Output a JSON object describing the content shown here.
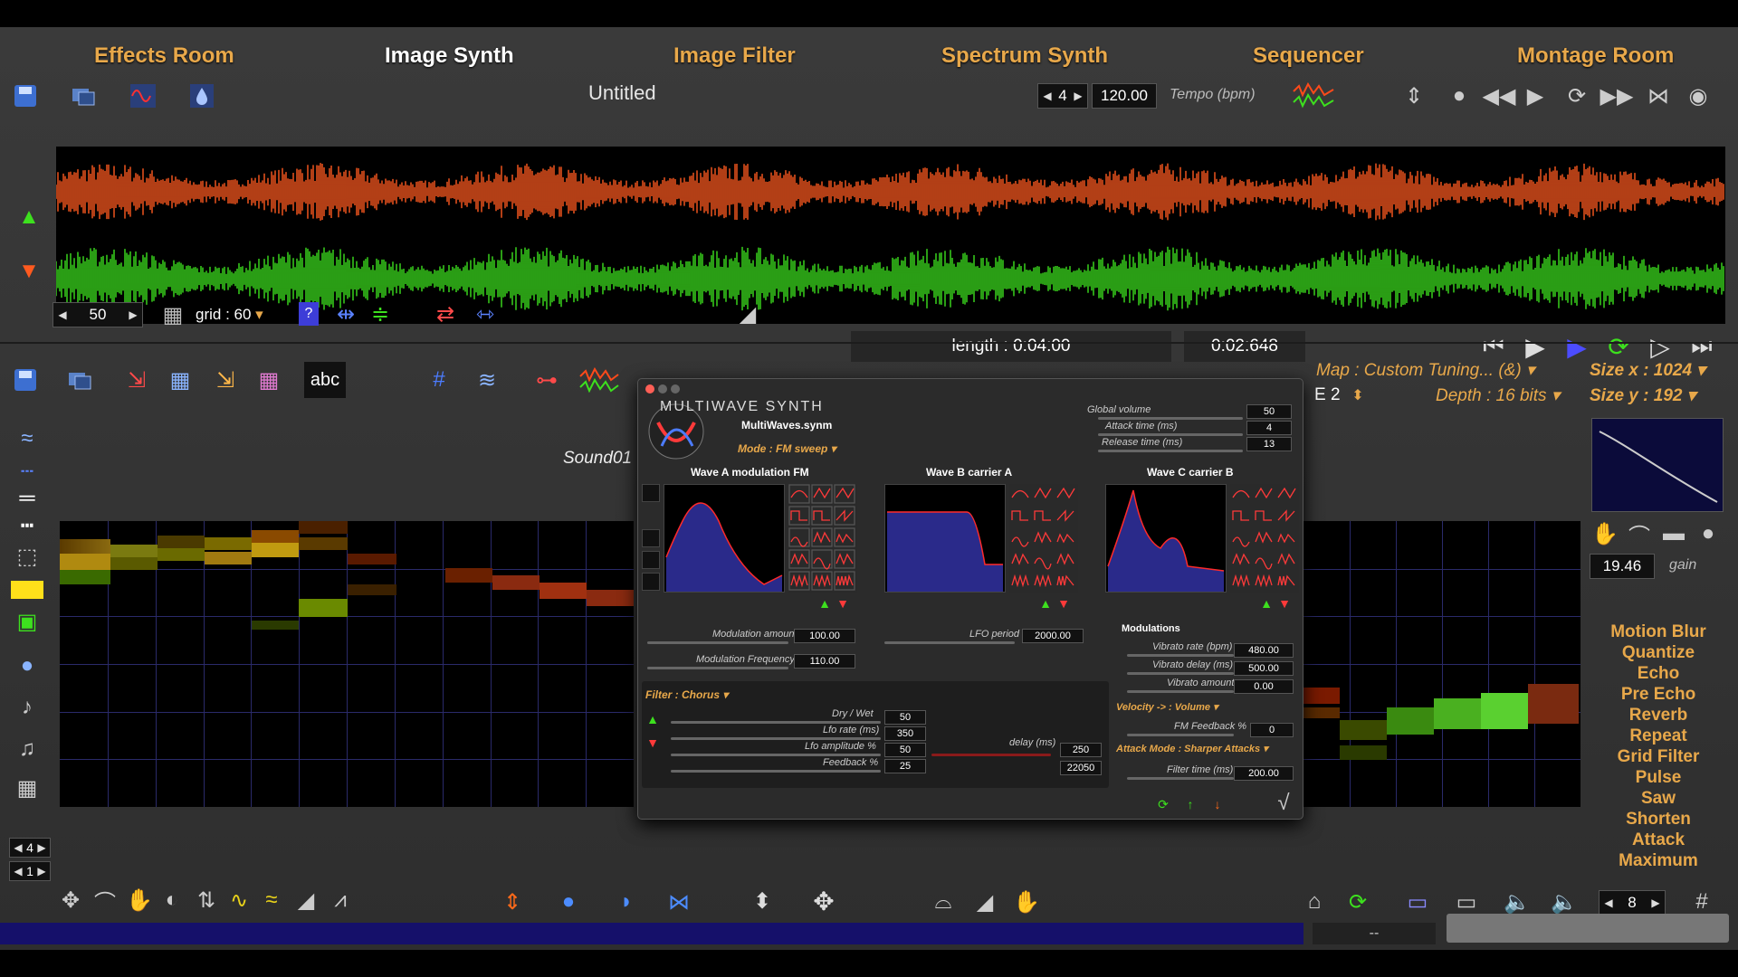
{
  "nav": {
    "effects": "Effects Room",
    "image_synth": "Image Synth",
    "image_filter": "Image Filter",
    "spectrum_synth": "Spectrum Synth",
    "sequencer": "Sequencer",
    "montage": "Montage Room"
  },
  "top": {
    "title": "Untitled",
    "beats": "4",
    "tempo_value": "120.00",
    "tempo_label": "Tempo (bpm)"
  },
  "wave_toolbar": {
    "zoom": "50",
    "grid_label": "grid : 60",
    "length": "length : 0:04:00",
    "position": "0:02:648"
  },
  "image_area": {
    "sound_name": "Sound01",
    "map_label": "Map : Custom Tuning... (&)",
    "note": "E 2",
    "depth": "Depth : 16 bits",
    "size_x": "Size x : 1024",
    "size_y": "Size y : 192",
    "gain_value": "19.46",
    "gain_label": "gain",
    "abc": "abc",
    "left_step1": "4",
    "left_step2": "1"
  },
  "effects_list": [
    "Motion Blur",
    "Quantize",
    "Echo",
    "Pre Echo",
    "Reverb",
    "Repeat",
    "Grid Filter",
    "Pulse",
    "Saw",
    "Shorten",
    "Attack",
    "Maximum"
  ],
  "synth": {
    "title": "MULTIWAVE SYNTH",
    "file": "MultiWaves.synm",
    "mode": "Mode : FM sweep",
    "global_volume_label": "Global volume",
    "global_volume": "50",
    "attack_label": "Attack time (ms)",
    "attack": "4",
    "release_label": "Release time (ms)",
    "release": "13",
    "wave_a": "Wave A modulation FM",
    "wave_b": "Wave B carrier A",
    "wave_c": "Wave C carrier B",
    "mod_amount_label": "Modulation amount",
    "mod_amount": "100.00",
    "mod_freq_label": "Modulation Frequency",
    "mod_freq": "110.00",
    "lfo_period_label": "LFO period",
    "lfo_period": "2000.00",
    "modulations": "Modulations",
    "vibrato_rate_label": "Vibrato rate (bpm)",
    "vibrato_rate": "480.00",
    "vibrato_delay_label": "Vibrato delay (ms)",
    "vibrato_delay": "500.00",
    "vibrato_amount_label": "Vibrato amount",
    "vibrato_amount": "0.00",
    "velocity": "Velocity -> : Volume",
    "fm_feedback_label": "FM Feedback %",
    "fm_feedback": "0",
    "attack_mode": "Attack Mode : Sharper Attacks",
    "filter_time_label": "Filter time (ms)",
    "filter_time": "200.00",
    "filter": "Filter : Chorus",
    "dry_wet_label": "Dry / Wet",
    "dry_wet": "50",
    "lfo_rate_label": "Lfo rate (ms)",
    "lfo_rate": "350",
    "lfo_amp_label": "Lfo  amplitude %",
    "lfo_amp": "50",
    "feedback_label": "Feedback %",
    "feedback": "25",
    "delay_label": "delay (ms)",
    "delay": "250",
    "rate": "22050"
  },
  "bottom": {
    "volume_step": "8",
    "status": "--"
  },
  "colors": {
    "accent": "#e8a84a",
    "wave_top": "#ff5a1f",
    "wave_bottom": "#3de01e",
    "panel_bg": "#2e2e2e"
  }
}
